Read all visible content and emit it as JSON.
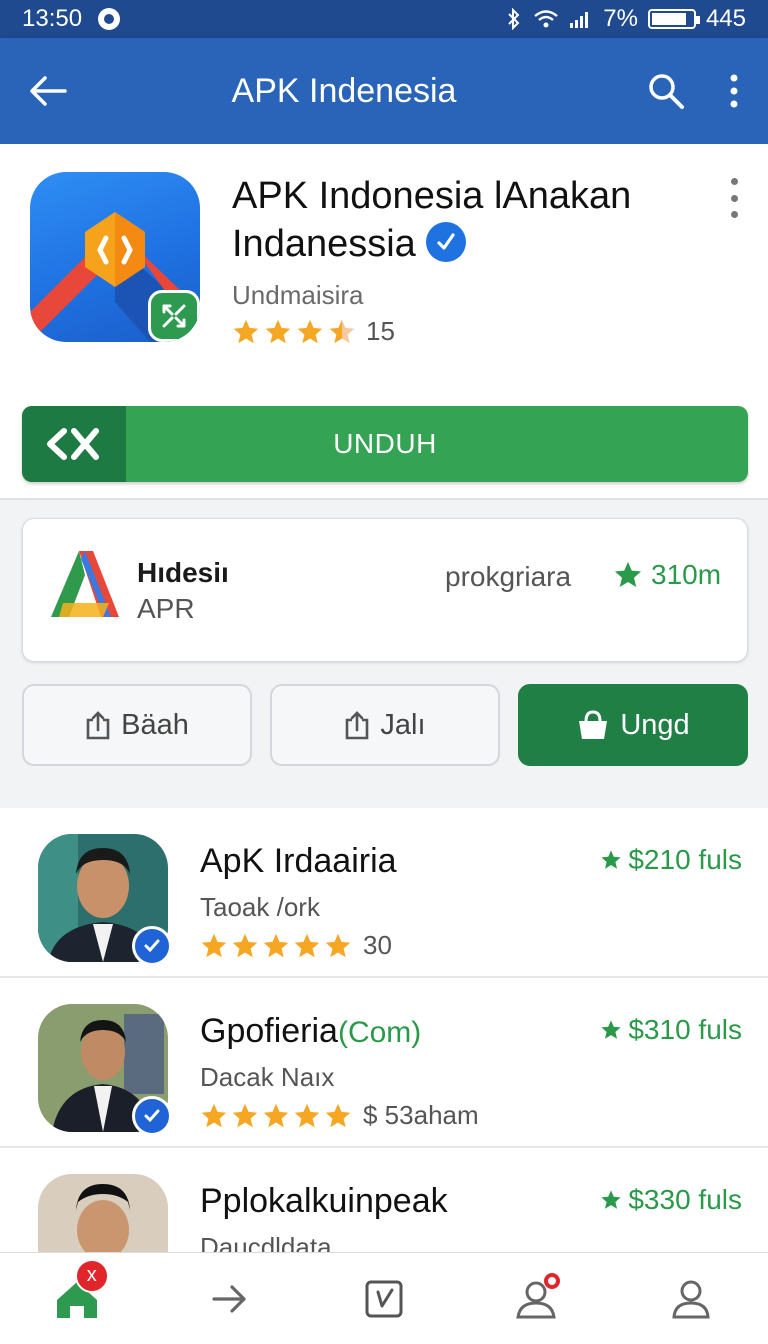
{
  "status_bar": {
    "time": "13:50",
    "battery_percent": "7%",
    "extra": "445"
  },
  "app_bar": {
    "title": "APK Indenesia"
  },
  "app": {
    "title_line1": "APK Indonesia lAnakan",
    "title_line2": "Indanessia",
    "developer": "Undmaisira",
    "rating_stars": 3.5,
    "rating_count": "15",
    "download_label": "UNDUH"
  },
  "info_card": {
    "name": "Hıdesiı",
    "sub": "APR",
    "category": "prokgriara",
    "score": "310m"
  },
  "actions": [
    {
      "label": "Bäah",
      "icon": "share-icon"
    },
    {
      "label": "Jalı",
      "icon": "share-icon"
    },
    {
      "label": "Ungd",
      "icon": "bag-icon"
    }
  ],
  "list": [
    {
      "name": "ApK Irdaairia",
      "name_suffix": "",
      "sub": "Taoak /ork",
      "stars": 5,
      "rating_text": "30",
      "price": "$210 fuls"
    },
    {
      "name": "Gpofieria",
      "name_suffix": "(Com)",
      "sub": "Dacak Naıx",
      "stars": 5,
      "rating_text": "$ 53aham",
      "price": "$310 fuls"
    },
    {
      "name": "Pplokalkuinpeak",
      "name_suffix": "",
      "sub": "Daucdldata",
      "stars": 0,
      "rating_text": "",
      "price": "$330 fuls"
    }
  ],
  "bottom_nav": {
    "items": [
      "home-icon",
      "forward-icon",
      "edit-icon",
      "people-icon",
      "profile-icon"
    ],
    "badge": "x"
  },
  "colors": {
    "primary_blue": "#2a64b8",
    "green": "#34a354",
    "dark_green": "#1f7f45",
    "star": "#f5a623"
  }
}
